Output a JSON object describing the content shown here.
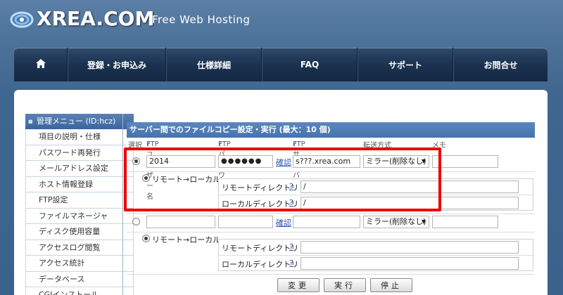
{
  "header": {
    "logo_text": "XREA.COM",
    "tagline": "Free Web Hosting"
  },
  "nav": {
    "items": [
      {
        "icon": "home-icon",
        "label": ""
      },
      {
        "label": "登録・お申込み"
      },
      {
        "label": "仕様詳細"
      },
      {
        "label": "FAQ"
      },
      {
        "label": "サポート"
      },
      {
        "label": "お問合せ"
      }
    ]
  },
  "sidebar": {
    "title": "管理メニュー (ID:hcz)",
    "items": [
      "項目の説明・仕様",
      "パスワード再発行",
      "メールアドレス設定",
      "ホスト情報登録",
      "FTP設定",
      "ファイルマネージャ",
      "ディスク使用容量",
      "アクセスログ閲覧",
      "アクセス統計",
      "データベース",
      "CGIインストール"
    ]
  },
  "section": {
    "title": "サーバー間でのファイルコピー設定・実行 (最大：10 個)",
    "columns": {
      "select": "選択",
      "ftp_user": "FTPユーザー名",
      "ftp_pass": "FTPパスワード",
      "ftp_server": "FTPサーバー名",
      "transfer": "転送方式",
      "memo": "メモ",
      "help": "?"
    }
  },
  "entries": [
    {
      "selected": true,
      "user": "2014",
      "password": "●●●●●●",
      "confirm": "確認",
      "server": "s???.xrea.com",
      "mode": "ミラー(削除なし)",
      "memo": "",
      "direction": "リモート→ローカル",
      "remote_dir_label": "リモートディレクトリ",
      "remote_dir": "/",
      "local_dir_label": "ローカルディレクトリ",
      "local_dir": "/",
      "help": "?"
    },
    {
      "selected": false,
      "user": "",
      "password": "",
      "confirm": "確認",
      "server": "",
      "mode": "ミラー(削除なし)",
      "memo": "",
      "direction": "リモート→ローカル",
      "remote_dir_label": "リモートディレクトリ",
      "remote_dir": "",
      "local_dir_label": "ローカルディレクトリ",
      "local_dir": "",
      "help": "?"
    }
  ],
  "buttons": {
    "change": "変更",
    "execute": "実行",
    "stop": "停止"
  },
  "colors": {
    "highlight": "#ee0000",
    "nav_bg": "#1b3250",
    "section_head": "#4573ad"
  }
}
